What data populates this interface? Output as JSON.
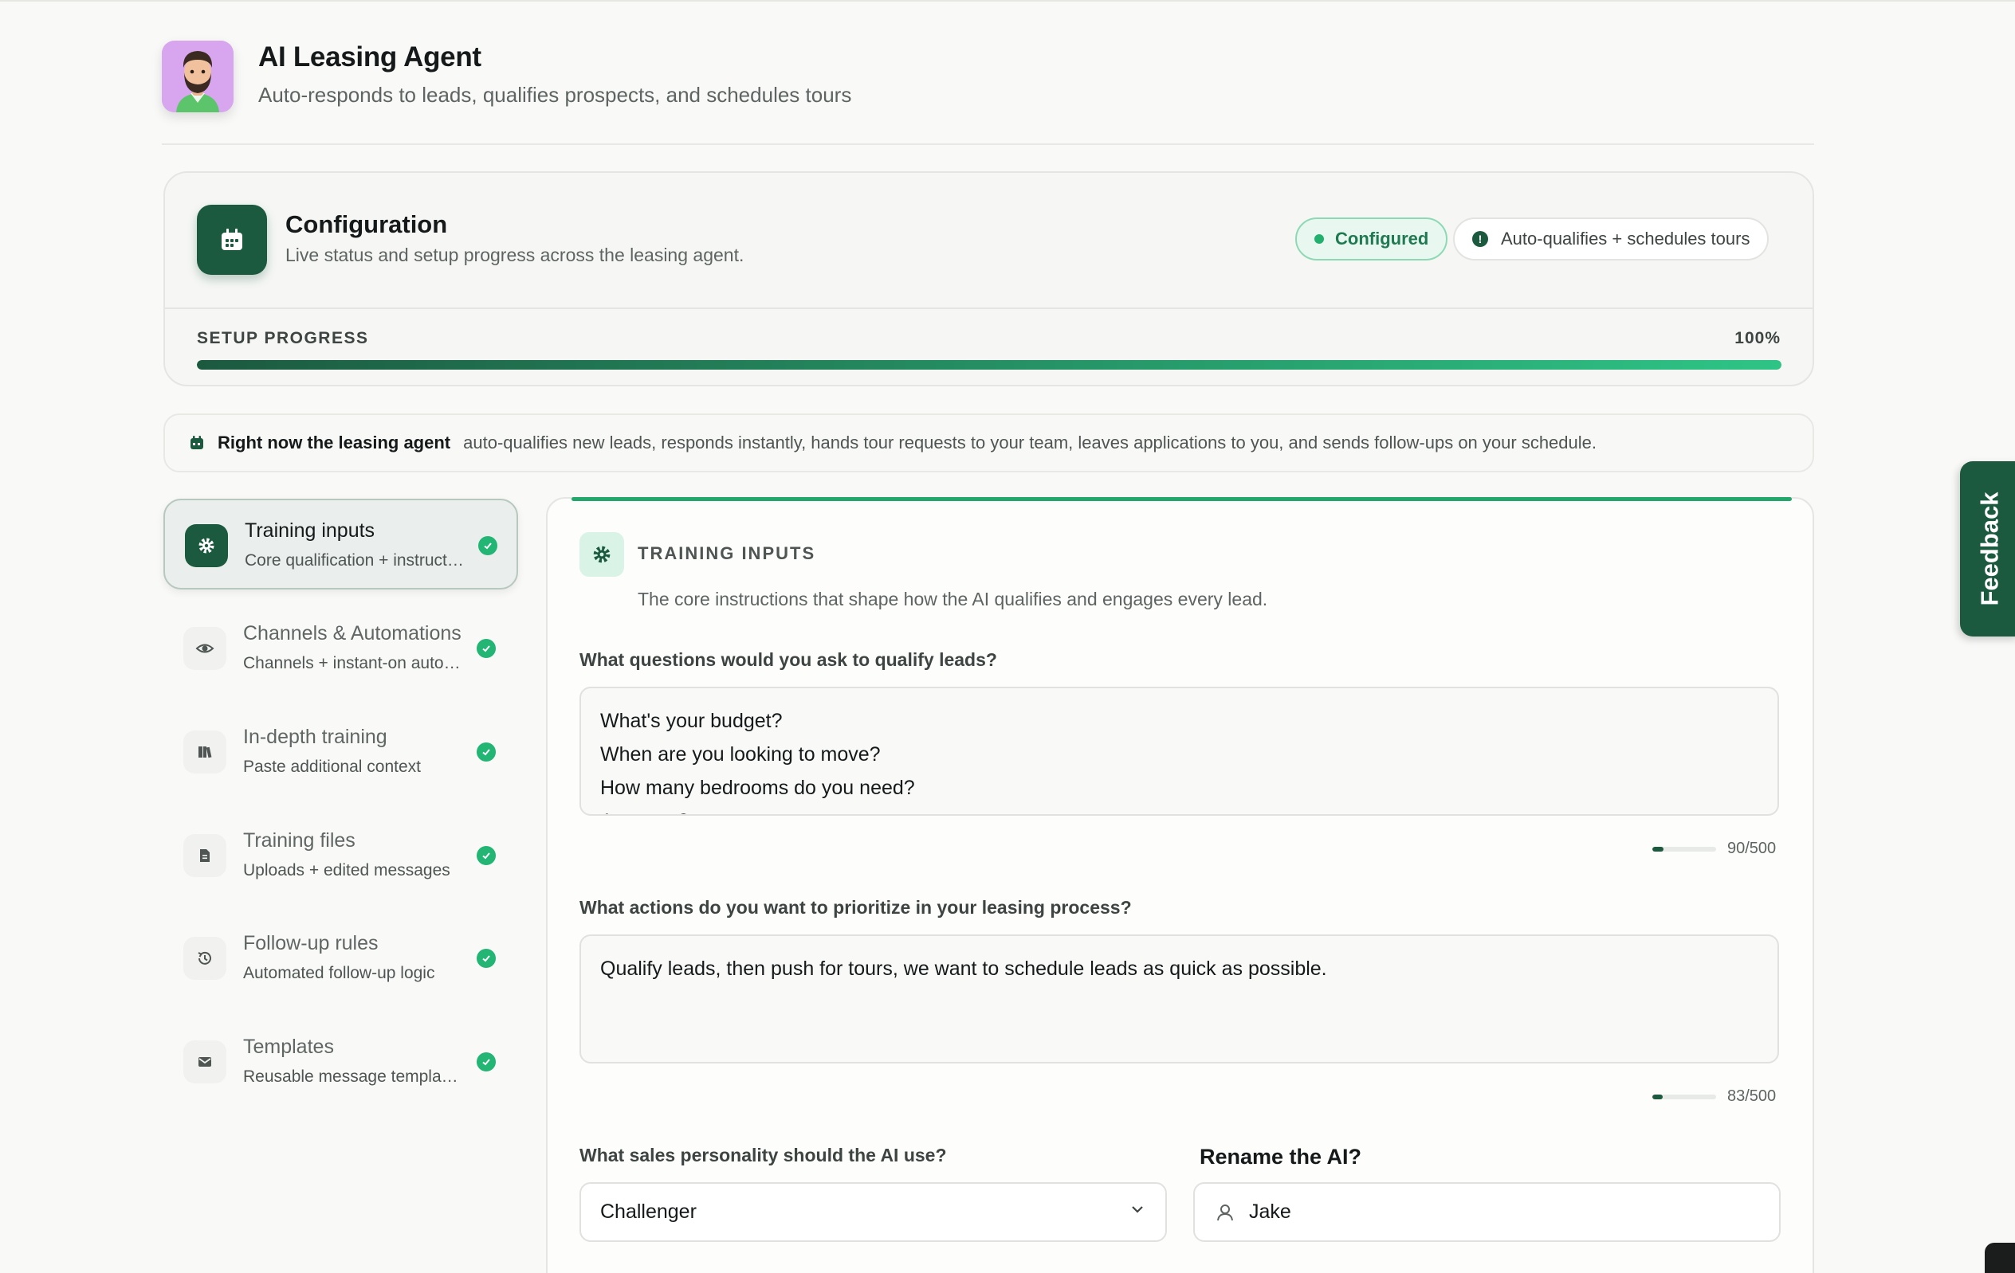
{
  "header": {
    "title": "AI Leasing Agent",
    "subtitle": "Auto-responds to leads, qualifies prospects, and schedules tours"
  },
  "config": {
    "title": "Configuration",
    "subtitle": "Live status and setup progress across the leasing agent.",
    "status_pill": "Configured",
    "info_pill": "Auto-qualifies + schedules tours",
    "progress_label": "SETUP PROGRESS",
    "progress_text": "100%",
    "progress_value": 1.0
  },
  "banner": {
    "strong": "Right now the leasing agent",
    "text": "auto-qualifies new leads, responds instantly, hands tour requests to your team, leaves applications to you, and sends follow-ups on your schedule."
  },
  "sidebar": {
    "items": [
      {
        "title": "Training inputs",
        "subtitle": "Core qualification + instructions",
        "icon": "gear-icon",
        "active": true,
        "complete": true
      },
      {
        "title": "Channels & Automations",
        "subtitle": "Channels + instant-on automations",
        "icon": "eye-icon",
        "active": false,
        "complete": true
      },
      {
        "title": "In-depth training",
        "subtitle": "Paste additional context",
        "icon": "books-icon",
        "active": false,
        "complete": true
      },
      {
        "title": "Training files",
        "subtitle": "Uploads + edited messages",
        "icon": "file-icon",
        "active": false,
        "complete": true
      },
      {
        "title": "Follow-up rules",
        "subtitle": "Automated follow-up logic",
        "icon": "history-icon",
        "active": false,
        "complete": true
      },
      {
        "title": "Templates",
        "subtitle": "Reusable message templates",
        "icon": "mail-icon",
        "active": false,
        "complete": true
      }
    ]
  },
  "panel": {
    "title": "TRAINING INPUTS",
    "description": "The core instructions that shape how the AI qualifies and engages every lead.",
    "q1": {
      "label": "What questions would you ask to qualify leads?",
      "value": "What's your budget?\nWhen are you looking to move?\nHow many bedrooms do you need?\nAny pets?",
      "counter": "90/500",
      "fill": 0.18
    },
    "q2": {
      "label": "What actions do you want to prioritize in your leasing process?",
      "value": "Qualify leads, then push for tours, we want to schedule leads as quick as possible.",
      "counter": "83/500",
      "fill": 0.166
    },
    "personality": {
      "label": "What sales personality should the AI use?",
      "value": "Challenger"
    },
    "rename": {
      "label": "Rename the AI?",
      "value": "Jake"
    }
  },
  "feedback": {
    "label": "Feedback"
  },
  "colors": {
    "brand": "#1c5a40",
    "accent": "#22b573",
    "progress_end": "#2ec486"
  }
}
